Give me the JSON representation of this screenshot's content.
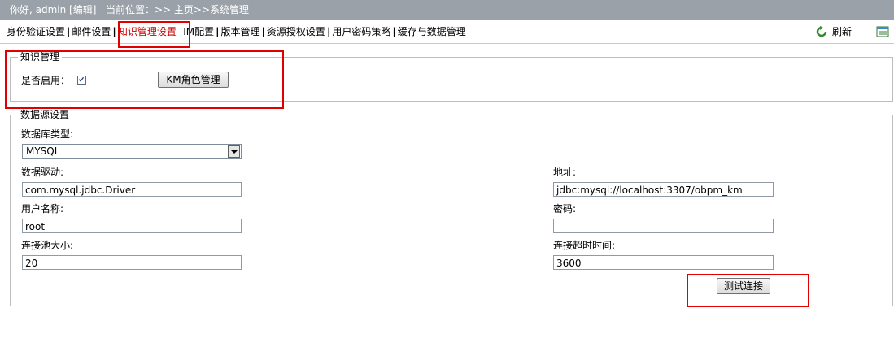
{
  "topbar": {
    "greeting": "你好, admin [编辑]",
    "location": "当前位置：>> 主页>>系统管理"
  },
  "nav": {
    "items": [
      {
        "label": "身份验证设置"
      },
      {
        "label": "邮件设置"
      },
      {
        "label": "知识管理设置",
        "active": true
      },
      {
        "label": "IM配置"
      },
      {
        "label": "版本管理"
      },
      {
        "label": "资源授权设置"
      },
      {
        "label": "用户密码策略"
      },
      {
        "label": "缓存与数据管理"
      }
    ],
    "refresh_label": "刷新",
    "refresh_icon": "refresh-icon",
    "export_icon": "export-icon"
  },
  "km": {
    "legend": "知识管理",
    "enable_label": "是否启用：",
    "enabled": true,
    "role_button": "KM角色管理"
  },
  "datasource": {
    "legend": "数据源设置",
    "db_type_label": "数据库类型:",
    "db_type_value": "MYSQL",
    "driver_label": "数据驱动:",
    "driver_value": "com.mysql.jdbc.Driver",
    "address_label": "地址:",
    "address_value": "jdbc:mysql://localhost:3307/obpm_km",
    "username_label": "用户名称:",
    "username_value": "root",
    "password_label": "密码:",
    "password_value": "",
    "pool_label": "连接池大小:",
    "pool_value": "20",
    "timeout_label": "连接超时时间:",
    "timeout_value": "3600",
    "test_button": "测试连接"
  },
  "colors": {
    "topbar_bg": "#9aa1a8",
    "active_tab": "#cc0000",
    "highlight_box": "#e00000"
  }
}
